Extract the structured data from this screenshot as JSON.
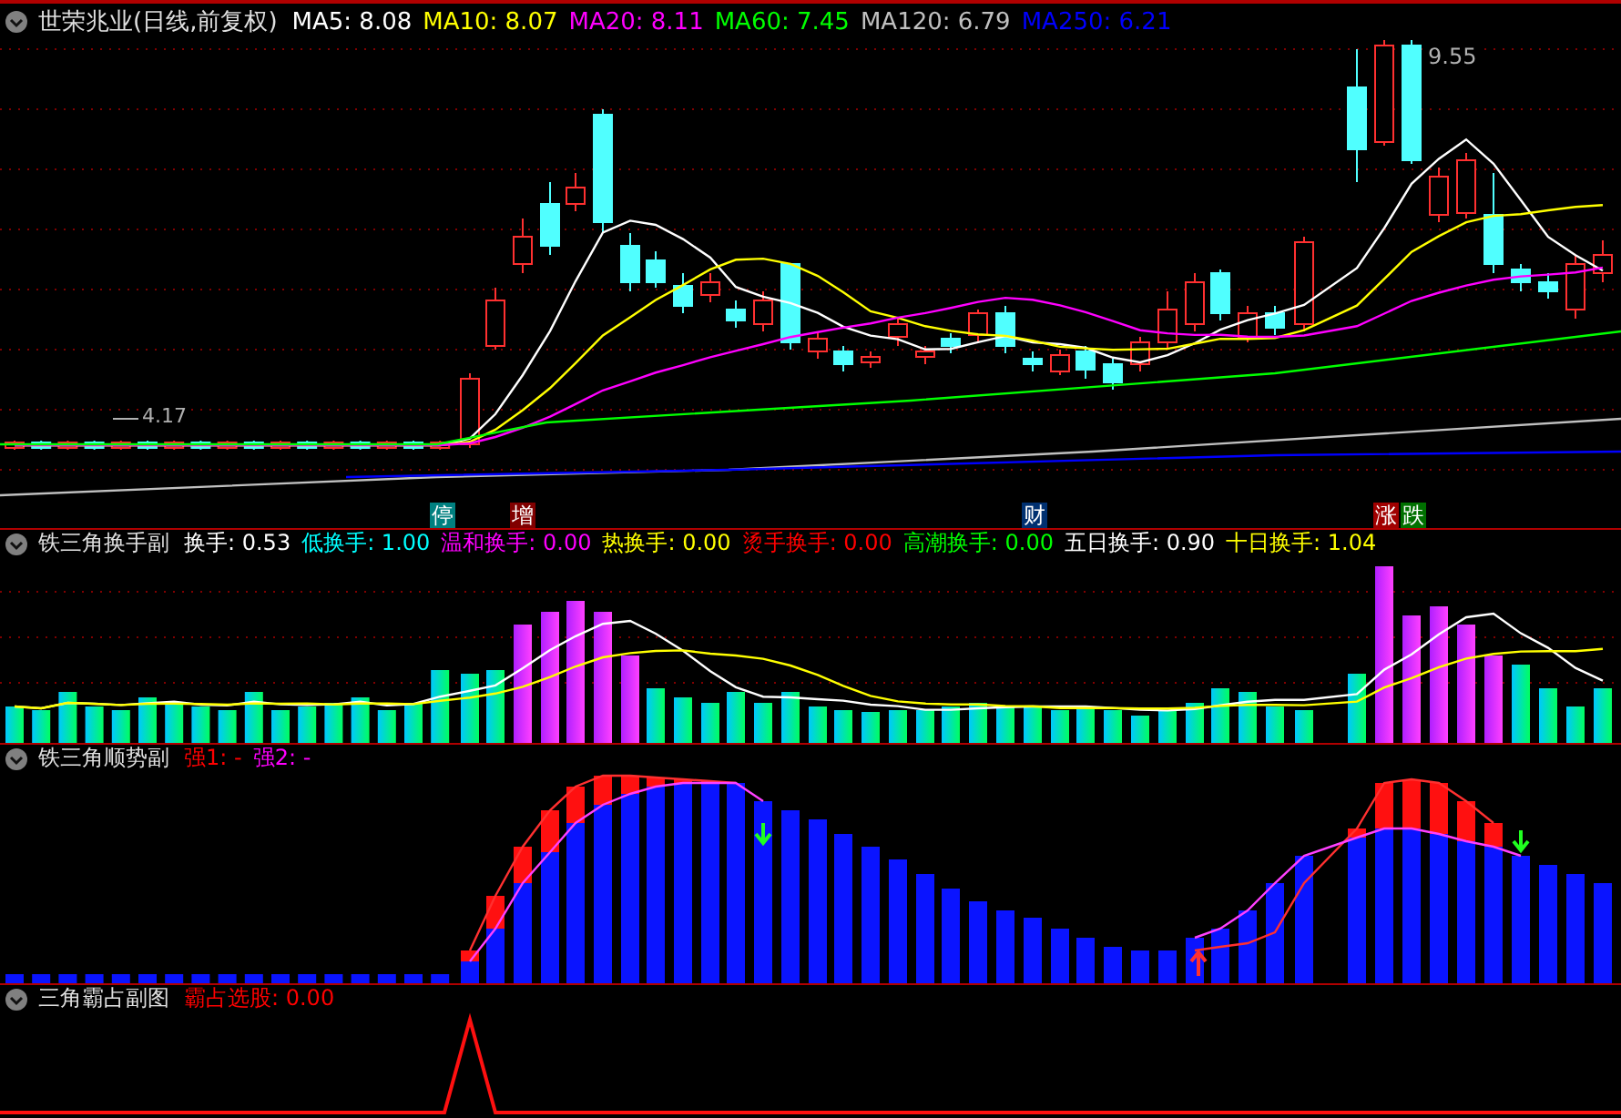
{
  "main": {
    "title": "世荣兆业(日线,前复权)",
    "indicators": [
      {
        "label": "MA5: 8.08",
        "color": "#ffffff"
      },
      {
        "label": "MA10: 8.07",
        "color": "#ffff00"
      },
      {
        "label": "MA20: 8.11",
        "color": "#ff00ff"
      },
      {
        "label": "MA60: 7.45",
        "color": "#00ff00"
      },
      {
        "label": "MA120: 6.79",
        "color": "#c0c0c0"
      },
      {
        "label": "MA250: 6.21",
        "color": "#0000ff"
      }
    ],
    "high_label": "9.55",
    "low_label": "4.17",
    "markers": [
      {
        "text": "停",
        "color": "#008080"
      },
      {
        "text": "增",
        "color": "#800000"
      },
      {
        "text": "财",
        "color": "#003070"
      },
      {
        "text": "涨",
        "color": "#a00000"
      },
      {
        "text": "跌",
        "color": "#007000"
      }
    ]
  },
  "panels": [
    {
      "title": "铁三角换手副",
      "indicators": [
        {
          "label": "换手: 0.53",
          "color": "#ffffff"
        },
        {
          "label": "低换手: 1.00",
          "color": "#00ffff"
        },
        {
          "label": "温和换手: 0.00",
          "color": "#ff00ff"
        },
        {
          "label": "热换手: 0.00",
          "color": "#ffff00"
        },
        {
          "label": "烫手换手: 0.00",
          "color": "#ff0000"
        },
        {
          "label": "高潮换手: 0.00",
          "color": "#00ff00"
        },
        {
          "label": "五日换手: 0.90",
          "color": "#ffffff"
        },
        {
          "label": "十日换手: 1.04",
          "color": "#ffff00"
        }
      ]
    },
    {
      "title": "铁三角顺势副",
      "indicators": [
        {
          "label": "强1: -",
          "color": "#ff0000"
        },
        {
          "label": "强2: -",
          "color": "#ff00ff"
        }
      ]
    },
    {
      "title": "三角霸占副图",
      "indicators": [
        {
          "label": "霸占选股: 0.00",
          "color": "#ff0000"
        }
      ]
    }
  ]
}
